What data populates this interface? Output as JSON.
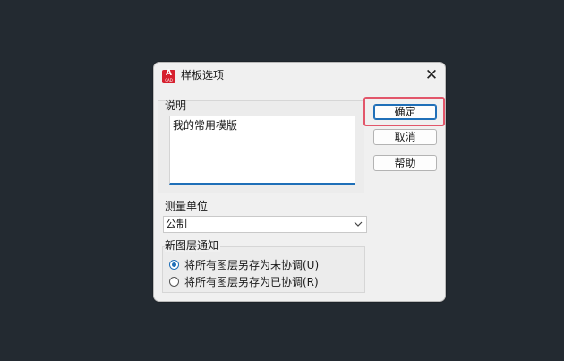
{
  "dialog": {
    "title": "样板选项",
    "app_icon_letter": "A",
    "app_icon_sub": "CAD",
    "close_symbol": "✕"
  },
  "description": {
    "label": "说明",
    "value": "我的常用模版"
  },
  "buttons": {
    "ok": "确定",
    "cancel": "取消",
    "help": "帮助"
  },
  "measurement": {
    "label": "测量单位",
    "selected": "公制"
  },
  "new_layer_notify": {
    "label": "新图层通知",
    "options": [
      {
        "label": "将所有图层另存为未协调(U)",
        "checked": true
      },
      {
        "label": "将所有图层另存为已协调(R)",
        "checked": false
      }
    ]
  },
  "colors": {
    "background": "#232a31",
    "accent": "#1f6fb8",
    "highlight": "#e2566a",
    "app_icon": "#d6202e"
  }
}
